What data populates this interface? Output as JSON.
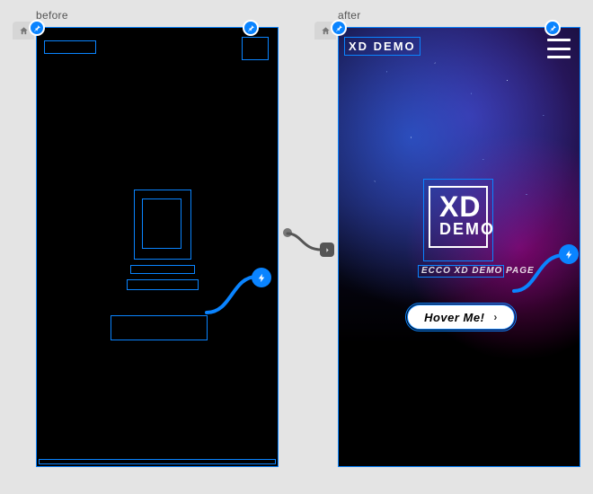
{
  "labels": {
    "before": "before",
    "after": "after"
  },
  "after": {
    "brand": "XD DEMO",
    "logo_line1": "XD",
    "logo_line2": "DEMO",
    "tagline": "ECCO XD DEMO PAGE",
    "button_label": "Hover Me!",
    "button_chev": "›"
  }
}
